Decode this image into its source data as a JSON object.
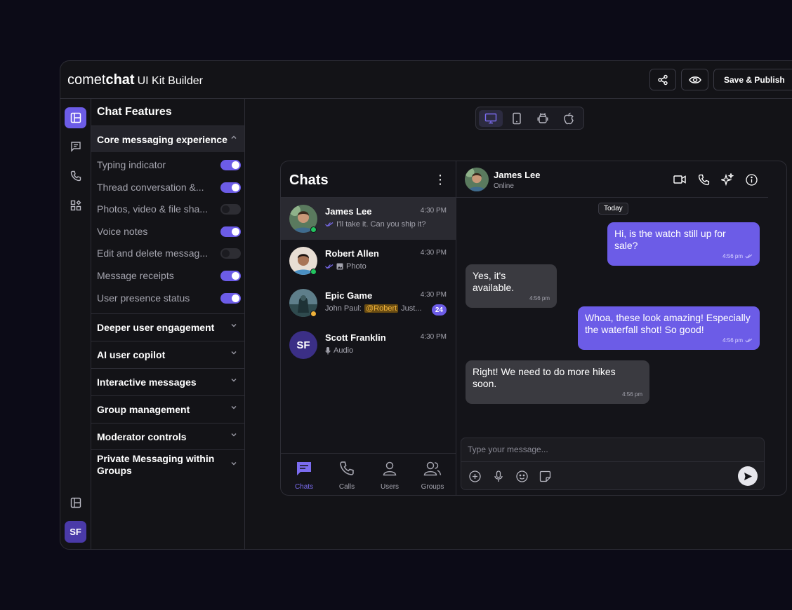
{
  "app": {
    "logo_light": "comet",
    "logo_bold": "chat",
    "logo_sub": "UI Kit Builder",
    "save_publish_label": "Save & Publish"
  },
  "features": {
    "title": "Chat Features",
    "core_section": {
      "label": "Core messaging experience",
      "items": [
        {
          "label": "Typing indicator",
          "enabled": true
        },
        {
          "label": "Thread conversation &...",
          "enabled": true
        },
        {
          "label": "Photos, video & file sha...",
          "enabled": false
        },
        {
          "label": "Voice notes",
          "enabled": true
        },
        {
          "label": "Edit and delete messag...",
          "enabled": false
        },
        {
          "label": "Message receipts",
          "enabled": true
        },
        {
          "label": "User presence status",
          "enabled": true
        }
      ]
    },
    "sections": [
      "Deeper user engagement",
      "AI user copilot",
      "Interactive messages",
      "Group management",
      "Moderator controls",
      "Private Messaging within Groups"
    ]
  },
  "user_initials": "SF",
  "preview": {
    "chats_title": "Chats",
    "conversations": [
      {
        "name": "James Lee",
        "time": "4:30 PM",
        "preview": "I'll take it. Can you ship it?"
      },
      {
        "name": "Robert Allen",
        "time": "4:30 PM",
        "preview": "Photo"
      },
      {
        "name": "Epic Game",
        "time": "4:30 PM",
        "preview_prefix": "John Paul:",
        "mention": "@Robert",
        "preview_suffix": "Just...",
        "unread": "24"
      },
      {
        "name": "Scott Franklin",
        "time": "4:30 PM",
        "preview": "Audio",
        "initials": "SF"
      }
    ],
    "tabs": [
      "Chats",
      "Calls",
      "Users",
      "Groups"
    ],
    "header": {
      "name": "James Lee",
      "status": "Online"
    },
    "date_separator": "Today",
    "messages": [
      {
        "text": "Hi, is the watch still up for sale?",
        "time": "4:56 pm",
        "direction": "out"
      },
      {
        "text": "Yes, it's available.",
        "time": "4:56 pm",
        "direction": "in"
      },
      {
        "text": "Whoa, these look amazing! Especially the waterfall shot! So good!",
        "time": "4:56 pm",
        "direction": "out"
      },
      {
        "text": "Right! We need to do more hikes soon.",
        "time": "4:56 pm",
        "direction": "in"
      }
    ],
    "composer_placeholder": "Type your message..."
  },
  "colors": {
    "accent": "#6c5ce7",
    "background": "#0c0b17",
    "panel": "#131317",
    "online": "#22c55e",
    "mention": "#f0b23a"
  }
}
